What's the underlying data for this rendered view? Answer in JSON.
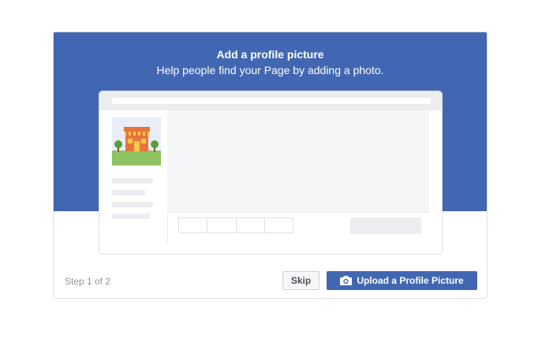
{
  "dialog": {
    "title": "Add a profile picture",
    "subtitle": "Help people find your Page by adding a photo.",
    "step_text": "Step 1 of 2",
    "skip_label": "Skip",
    "upload_label": "Upload a Profile Picture",
    "upload_icon": "camera-icon"
  },
  "colors": {
    "banner": "#4267b2",
    "primary_button": "#4267b2",
    "step_text": "#90949c"
  }
}
